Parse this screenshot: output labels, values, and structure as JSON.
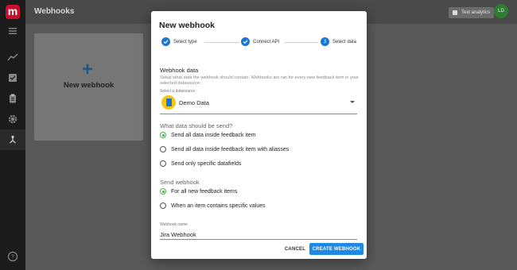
{
  "app": {
    "logo_letter": "m"
  },
  "sidebar": {
    "icons": [
      "menu-icon",
      "chart-line-icon",
      "checklist-icon",
      "clipboard-icon",
      "gear-icon",
      "webhook-icon",
      "help-icon"
    ]
  },
  "header": {
    "title": "Webhooks",
    "badge_label": "Text analytics",
    "avatar_initials": "LD"
  },
  "card": {
    "plus": "+",
    "label": "New webhook"
  },
  "dialog": {
    "title": "New webhook",
    "steps": [
      {
        "number": "1",
        "label": "Select type",
        "state": "completed"
      },
      {
        "number": "2",
        "label": "Connect API",
        "state": "completed"
      },
      {
        "number": "3",
        "label": "Select data",
        "state": "active"
      }
    ],
    "webhook_data": {
      "heading": "Webhook data",
      "helper": "Setup what data the webhook should contain. Webhooks are ran for every new feedback item in your selected datasource."
    },
    "datasource": {
      "label": "Select a datasource",
      "value": "Demo Data"
    },
    "send_data": {
      "heading": "What data should be send?",
      "options": [
        {
          "label": "Send all data inside feedback item",
          "checked": true
        },
        {
          "label": "Send all data inside feedback item with aliasses",
          "checked": false
        },
        {
          "label": "Send only specific datafields",
          "checked": false
        }
      ]
    },
    "send_webhook": {
      "heading": "Send webhook",
      "options": [
        {
          "label": "For all new feedback items",
          "checked": true
        },
        {
          "label": "When an item contains specific values",
          "checked": false
        }
      ]
    },
    "name_field": {
      "label": "Webhook name",
      "value": "Jira Webhook"
    },
    "cancel_label": "CANCEL",
    "create_label": "CREATE WEBHOOK"
  },
  "colors": {
    "accent": "#1e88e5",
    "radio_checked": "#4caf50",
    "brand": "#c8102e",
    "datasource_icon": "#f5c518"
  }
}
